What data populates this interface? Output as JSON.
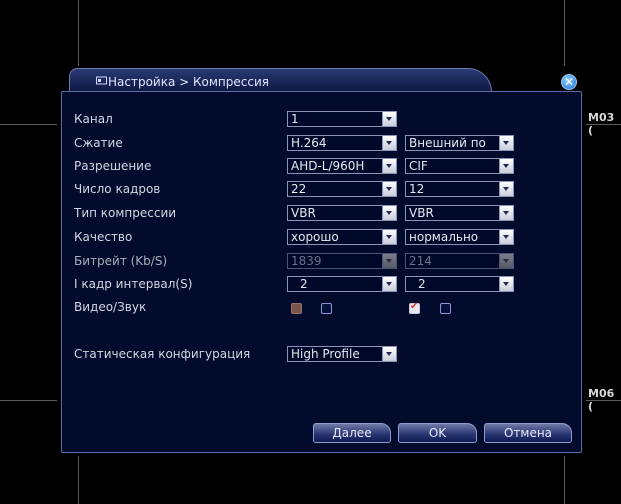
{
  "background": {
    "channel_labels": [
      "M03 (",
      "M06 ("
    ]
  },
  "dialog": {
    "title": "Настройка > Компрессия",
    "close_glyph": "✕",
    "rows": {
      "channel": {
        "label": "Канал",
        "value": "1"
      },
      "compression": {
        "label": "Сжатие",
        "main": "H.264",
        "extra": "Внешний по"
      },
      "resolution": {
        "label": "Разрешение",
        "main": "AHD-L/960H",
        "extra": "CIF"
      },
      "fps": {
        "label": "Число кадров",
        "main": "22",
        "extra": "12"
      },
      "bitrate_type": {
        "label": "Тип компрессии",
        "main": "VBR",
        "extra": "VBR"
      },
      "quality": {
        "label": "Качество",
        "main": "хорошо",
        "extra": "нормально"
      },
      "bitrate": {
        "label": "Битрейт (Kb/S)",
        "main": "1839",
        "extra": "214"
      },
      "iframe": {
        "label": "I кадр интервал(S)",
        "main": "2",
        "extra": "2"
      },
      "av": {
        "label": "Видео/Звук"
      },
      "static": {
        "label": "Статическая конфигурация",
        "value": "High Profile"
      }
    },
    "buttons": {
      "next": "Далее",
      "ok": "OK",
      "cancel": "Отмена"
    }
  }
}
